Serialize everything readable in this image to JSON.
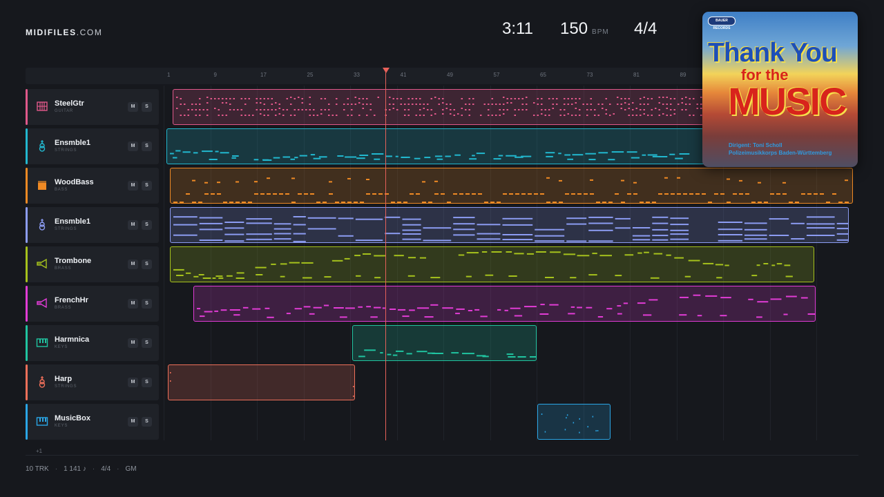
{
  "brand": {
    "name": "MIDIFILES",
    "domain": ".COM"
  },
  "stats": {
    "time": "3:11",
    "tempo": "150",
    "tempo_unit": "BPM",
    "signature": "4/4"
  },
  "ruler": {
    "ticks": [
      "1",
      "9",
      "17",
      "25",
      "33",
      "41",
      "49",
      "57",
      "65",
      "73",
      "81",
      "89"
    ]
  },
  "tracks": [
    {
      "name": "SteelGtr",
      "category": "GUITAR",
      "color": "#e0588a",
      "icon": "guitar-grid-icon",
      "mute": "M",
      "solo": "S"
    },
    {
      "name": "Ensmble1",
      "category": "STRINGS",
      "color": "#22b8cf",
      "icon": "violin-icon",
      "mute": "M",
      "solo": "S"
    },
    {
      "name": "WoodBass",
      "category": "BASS",
      "color": "#f08a24",
      "icon": "bass-amp-icon",
      "mute": "M",
      "solo": "S"
    },
    {
      "name": "Ensmble1",
      "category": "STRINGS",
      "color": "#8c9cf2",
      "icon": "violin-icon",
      "mute": "M",
      "solo": "S"
    },
    {
      "name": "Trombone",
      "category": "BRASS",
      "color": "#a6c21c",
      "icon": "horn-icon",
      "mute": "M",
      "solo": "S"
    },
    {
      "name": "FrenchHr",
      "category": "BRASS",
      "color": "#e23cd6",
      "icon": "horn-icon",
      "mute": "M",
      "solo": "S"
    },
    {
      "name": "Harmnica",
      "category": "KEYS",
      "color": "#20c4a0",
      "icon": "keyboard-icon",
      "mute": "M",
      "solo": "S"
    },
    {
      "name": "Harp",
      "category": "STRINGS",
      "color": "#f0705a",
      "icon": "violin-icon",
      "mute": "M",
      "solo": "S"
    },
    {
      "name": "MusicBox",
      "category": "KEYS",
      "color": "#2aa6e6",
      "icon": "keyboard-icon",
      "mute": "M",
      "solo": "S"
    }
  ],
  "more_tracks": "+1",
  "footer": {
    "tracks": "10 TRK",
    "notes": "1 141 ♪",
    "signature": "4/4",
    "standard": "GM"
  },
  "album": {
    "label": "BAUER RECORDS",
    "title_line1": "Thank You",
    "title_line2": "for the",
    "title_line3": "MUSIC",
    "credit1": "Dirigent: Toni Scholl",
    "credit2": "Polizeimusikkorps Baden-Württemberg"
  }
}
